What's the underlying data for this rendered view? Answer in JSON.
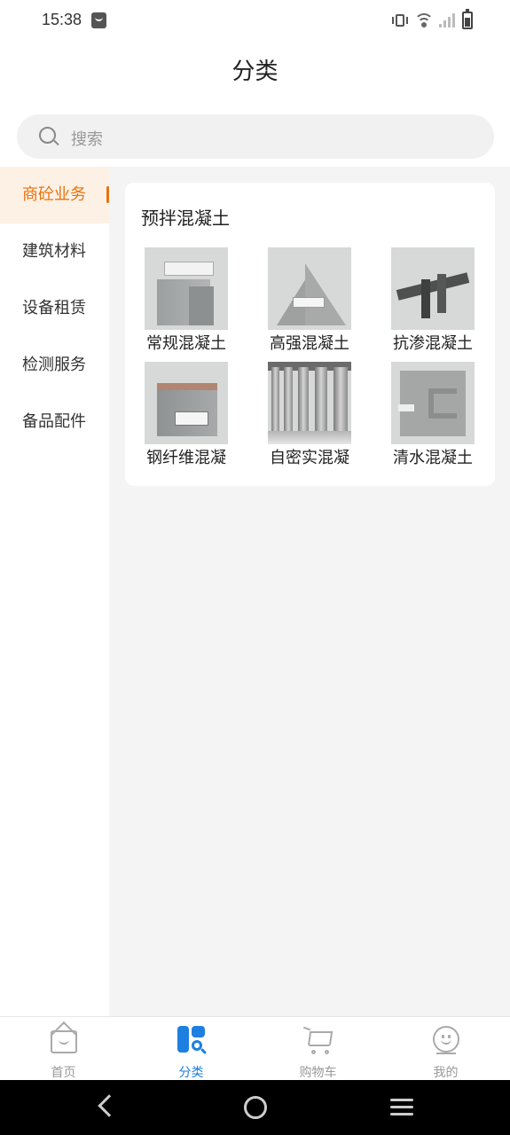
{
  "status_bar": {
    "time": "15:38"
  },
  "header": {
    "title": "分类"
  },
  "search": {
    "placeholder": "搜索"
  },
  "sidebar": {
    "items": [
      {
        "label": "商砼业务",
        "active": true
      },
      {
        "label": "建筑材料",
        "active": false
      },
      {
        "label": "设备租赁",
        "active": false
      },
      {
        "label": "检测服务",
        "active": false
      },
      {
        "label": "备品配件",
        "active": false
      }
    ]
  },
  "section": {
    "title": "预拌混凝土",
    "products": [
      {
        "label": "常规混凝土"
      },
      {
        "label": "高强混凝土"
      },
      {
        "label": "抗渗混凝土"
      },
      {
        "label": "钢纤维混凝"
      },
      {
        "label": "自密实混凝"
      },
      {
        "label": "清水混凝土"
      }
    ]
  },
  "tab_bar": {
    "items": [
      {
        "label": "首页",
        "icon": "home-icon",
        "active": false
      },
      {
        "label": "分类",
        "icon": "category-icon",
        "active": true
      },
      {
        "label": "购物车",
        "icon": "cart-icon",
        "active": false
      },
      {
        "label": "我的",
        "icon": "profile-icon",
        "active": false
      }
    ]
  },
  "colors": {
    "accent": "#e8720c",
    "active_tab": "#1d7fe0",
    "background": "#f4f4f4"
  }
}
